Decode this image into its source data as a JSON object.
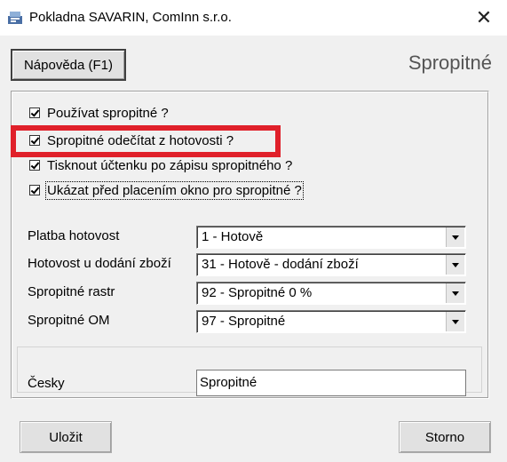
{
  "window": {
    "title": "Pokladna SAVARIN, ComInn s.r.o.",
    "close_glyph": "✕"
  },
  "toolbar": {
    "help_label": "Nápověda (F1)",
    "section_title": "Spropitné"
  },
  "checkboxes": [
    {
      "label": "Používat spropitné ?",
      "checked": true
    },
    {
      "label": "Spropitné odečítat z hotovosti ?",
      "checked": true
    },
    {
      "label": "Tisknout účtenku po zápisu spropitného ?",
      "checked": true
    },
    {
      "label": "Ukázat před placením okno pro spropitné ?",
      "checked": true
    }
  ],
  "fields": [
    {
      "label": "Platba hotovost",
      "value": "1 - Hotově"
    },
    {
      "label": "Hotovost u dodání zboží",
      "value": "31 - Hotově - dodání zboží"
    },
    {
      "label": "Spropitné rastr",
      "value": "92 - Spropitné 0 %"
    },
    {
      "label": "Spropitné OM",
      "value": "97 - Spropitné"
    }
  ],
  "language": {
    "label": "Česky",
    "value": "Spropitné"
  },
  "buttons": {
    "save_label": "Uložit",
    "cancel_label": "Storno"
  },
  "colors": {
    "highlight": "#e0202a",
    "window_bg": "#f0f0f0"
  }
}
